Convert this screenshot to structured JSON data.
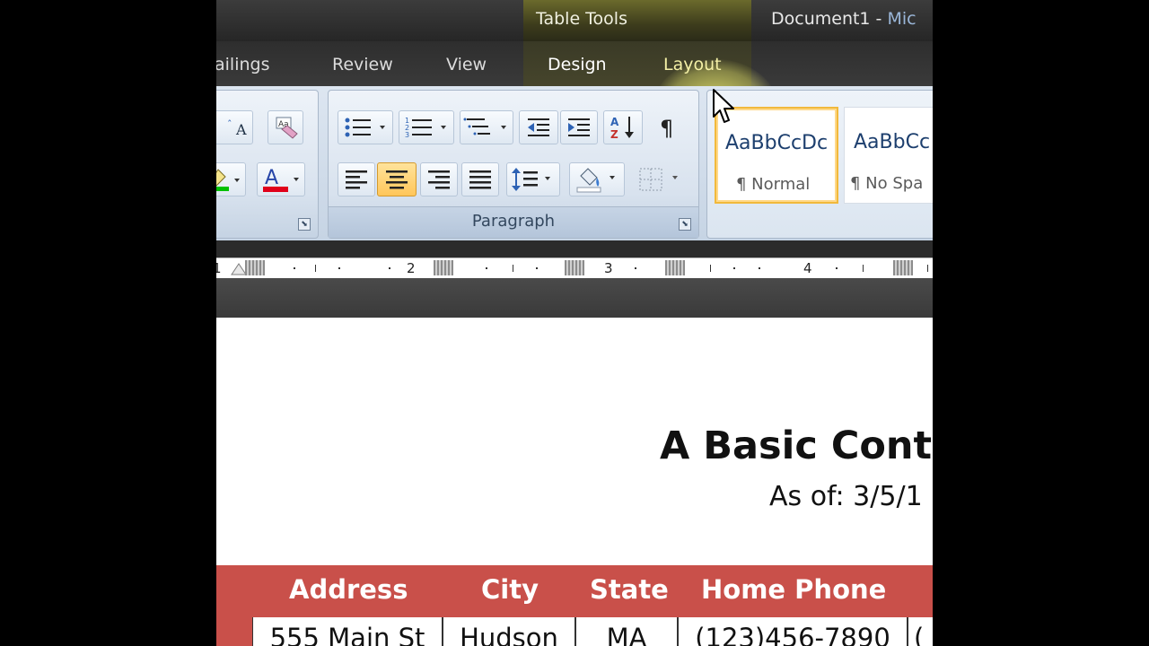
{
  "window": {
    "contextual_tab_group": "Table Tools",
    "document_title": "Document1 - ",
    "app_name_partial": "Mic"
  },
  "tabs": {
    "mailings": "ailings",
    "review": "Review",
    "view": "View",
    "design": "Design",
    "layout": "Layout"
  },
  "ribbon": {
    "paragraph_group_label": "Paragraph",
    "styles": [
      {
        "preview": "AaBbCcDc",
        "name": "¶ Normal",
        "selected": true
      },
      {
        "preview": "AaBbCc",
        "name": "¶ No Spa",
        "selected": false
      }
    ],
    "colors": {
      "highlight": "#00c000",
      "font_color": "#e0001a",
      "selected_button": "#ffc65a"
    }
  },
  "ruler": {
    "numbers": [
      "1",
      "2",
      "3",
      "4"
    ]
  },
  "document": {
    "heading": "A Basic Conta",
    "date_line": "As of: 3/5/1",
    "table": {
      "header_color": "#c9504a",
      "headers": [
        "Address",
        "City",
        "State",
        "Home Phone"
      ],
      "rows": [
        [
          "555 Main St",
          "Hudson",
          "MA",
          "(123)456-7890",
          "("
        ]
      ]
    }
  }
}
